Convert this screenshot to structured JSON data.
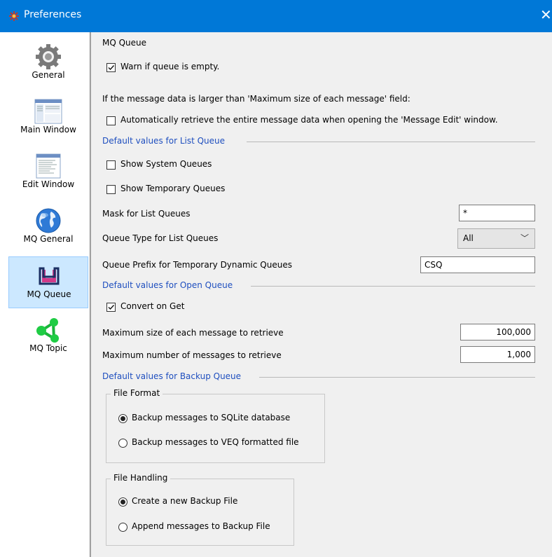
{
  "window": {
    "title": "Preferences"
  },
  "sidebar": {
    "items": [
      {
        "label": "General",
        "icon": "gear-icon"
      },
      {
        "label": "Main Window",
        "icon": "main-window-icon"
      },
      {
        "label": "Edit Window",
        "icon": "edit-window-icon"
      },
      {
        "label": "MQ General",
        "icon": "globe-icon"
      },
      {
        "label": "MQ Queue",
        "icon": "queue-icon",
        "selected": true
      },
      {
        "label": "MQ Topic",
        "icon": "topic-icon"
      }
    ]
  },
  "panel": {
    "title": "MQ Queue",
    "warn_empty": {
      "label": "Warn if queue is empty.",
      "checked": true
    },
    "large_msg_note": "If the message data is larger than 'Maximum size of each message' field:",
    "auto_retrieve": {
      "label": "Automatically retrieve the entire message data when opening the 'Message Edit' window.",
      "checked": false
    },
    "list_queue": {
      "title": "Default values for List Queue",
      "show_system": {
        "label": "Show System Queues",
        "checked": false
      },
      "show_temporary": {
        "label": "Show Temporary Queues",
        "checked": false
      },
      "mask": {
        "label": "Mask for List Queues",
        "value": "*"
      },
      "queue_type": {
        "label": "Queue Type for List Queues",
        "value": "All"
      },
      "prefix": {
        "label": "Queue Prefix for Temporary Dynamic Queues",
        "value": "CSQ"
      }
    },
    "open_queue": {
      "title": "Default values for Open Queue",
      "convert": {
        "label": "Convert on Get",
        "checked": true
      },
      "max_size": {
        "label": "Maximum size of each message to retrieve",
        "value": "100,000"
      },
      "max_count": {
        "label": "Maximum number of messages to retrieve",
        "value": "1,000"
      }
    },
    "backup_queue": {
      "title": "Default values for Backup Queue",
      "file_format": {
        "title": "File Format",
        "options": [
          {
            "label": "Backup messages to SQLite database",
            "selected": true
          },
          {
            "label": "Backup messages to VEQ formatted file",
            "selected": false
          }
        ]
      },
      "file_handling": {
        "title": "File Handling",
        "options": [
          {
            "label": "Create a new Backup File",
            "selected": true
          },
          {
            "label": "Append messages to Backup File",
            "selected": false
          }
        ]
      }
    }
  },
  "colors": {
    "titlebar": "#0078d7",
    "section_title": "#1f4fbf",
    "selected_nav": "#cce8ff"
  }
}
